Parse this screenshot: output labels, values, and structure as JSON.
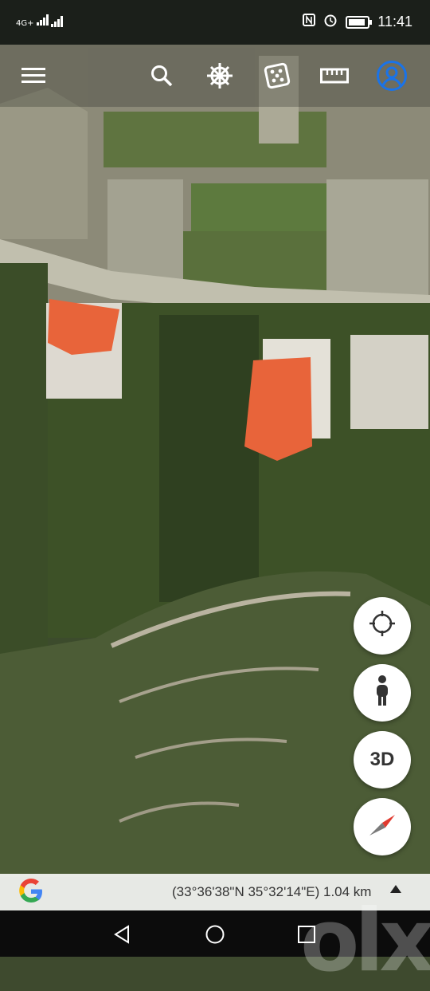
{
  "status_bar": {
    "network_label": "4G+",
    "time": "11:41",
    "battery_level": 0.8,
    "icons": [
      "nfc-icon",
      "alarm-icon",
      "battery-icon"
    ]
  },
  "toolbar": {
    "icons": [
      "menu-icon",
      "search-icon",
      "voyager-wheel-icon",
      "feeling-lucky-dice-icon",
      "measure-ruler-icon",
      "account-icon"
    ]
  },
  "map_controls": {
    "locate_icon": "my-location-icon",
    "street_view_icon": "pegman-icon",
    "view_3d_label": "3D",
    "compass_icon": "compass-icon"
  },
  "footer": {
    "google_logo": "G",
    "coordinates": "(33°36'38\"N 35°32'14\"E) 1.04 km",
    "expand_icon": "expand-up-icon"
  },
  "system_nav": {
    "icons": [
      "back-icon",
      "home-icon",
      "recents-icon"
    ]
  },
  "watermark": "olx",
  "colors": {
    "accent_blue": "#1a73e8",
    "roof_orange": "#e8643a",
    "vegetation": "#3e5228"
  }
}
